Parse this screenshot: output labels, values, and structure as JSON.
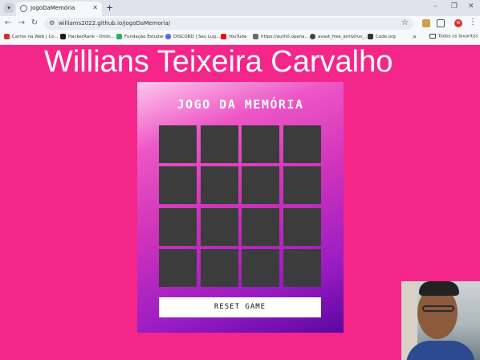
{
  "browser": {
    "tab": {
      "title": "JogoDaMemória",
      "favicon": "globe-icon"
    },
    "url": "williams2022.github.io/jogoDaMemoria/",
    "profile_initial": "W",
    "bookmarks": [
      {
        "label": "Carros na Web | Co...",
        "icon_color": "#d93025"
      },
      {
        "label": "HackerRank - Onlin...",
        "icon_color": "#1c1c1c"
      },
      {
        "label": "Fundação Estudar",
        "icon_color": "#2eaf5a"
      },
      {
        "label": "DISCORD | Seu Lug...",
        "icon_color": "#5865f2"
      },
      {
        "label": "YouTube",
        "icon_color": "#ff0000"
      },
      {
        "label": "https://auth0.opena...",
        "icon_color": "#6a6a6a"
      },
      {
        "label": "avast_free_antivirus_...",
        "icon_color": "#444444"
      },
      {
        "label": "Code.org",
        "icon_color": "#333333"
      }
    ],
    "bookmarks_folder": "Todos os favoritos"
  },
  "page": {
    "heading": "Willians Teixeira Carvalho",
    "background": "#f5268a",
    "game": {
      "title": "JOGO DA MEMÓRIA",
      "card_color": "#3c3c3c",
      "rows": 4,
      "cols": 4,
      "reset_label": "RESET GAME"
    }
  }
}
